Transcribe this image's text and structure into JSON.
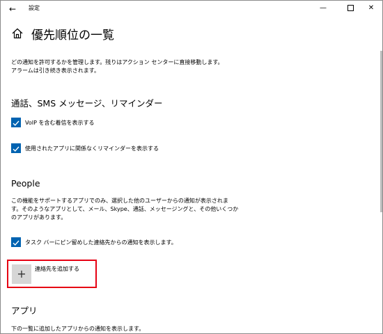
{
  "window": {
    "title": "設定",
    "back_glyph": "←",
    "minimize_glyph": "—",
    "close_glyph": "✕"
  },
  "header": {
    "title": "優先順位の一覧"
  },
  "description": {
    "line1": "どの通知を許可するかを管理します。残りはアクション センターに直接移動します。",
    "line2": "アラームは引き続き表示されます。"
  },
  "calls_section": {
    "title": "通話、SMS メッセージ、リマインダー",
    "checkboxes": [
      {
        "label": "VoIP を含む着信を表示する",
        "checked": true
      },
      {
        "label": "使用されたアプリに関係なくリマインダーを表示する",
        "checked": true
      }
    ]
  },
  "people_section": {
    "title": "People",
    "desc_line1": "この機能をサポートするアプリでのみ、選択した他のユーザーからの通知が表示されま",
    "desc_line2": "す。そのようなアプリとして、メール、Skype、通話、メッセージングと、その他いくつか",
    "desc_line3": "のアプリがあります。",
    "checkbox": {
      "label": "タスク バーにピン留めした連絡先からの通知を表示します。",
      "checked": true
    },
    "add_button": {
      "glyph": "+",
      "label": "連絡先を追加する"
    }
  },
  "apps_section": {
    "title": "アプリ",
    "desc": "下の一覧に追加したアプリからの通知を表示します。"
  },
  "colors": {
    "accent": "#0063b1",
    "highlight": "#e60012",
    "add_tile": "#d6d6d6"
  }
}
